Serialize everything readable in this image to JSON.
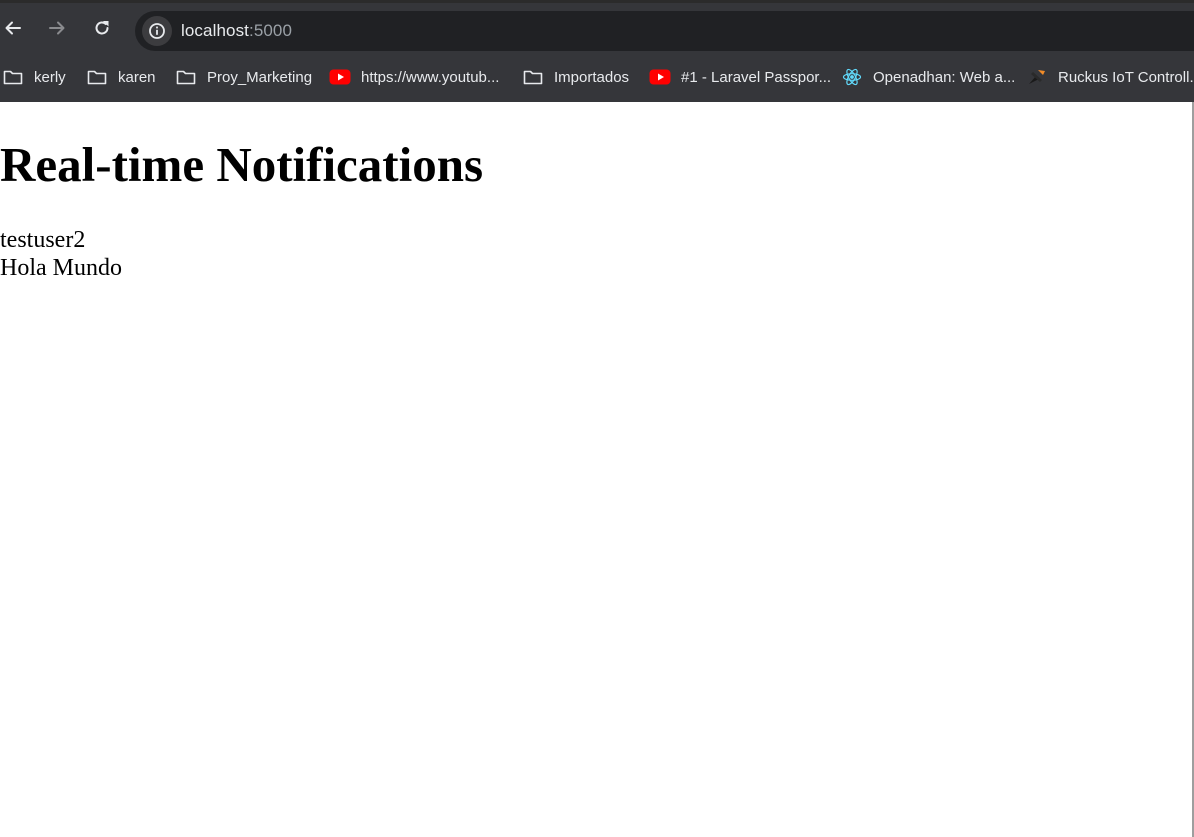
{
  "browser": {
    "url_host": "localhost",
    "url_port": ":5000",
    "bookmarks": [
      {
        "label": "kerly",
        "icon": "folder-icon"
      },
      {
        "label": "karen",
        "icon": "folder-icon"
      },
      {
        "label": "Proy_Marketing",
        "icon": "folder-icon"
      },
      {
        "label": "https://www.youtub...",
        "icon": "youtube-icon"
      },
      {
        "label": "Importados",
        "icon": "folder-icon"
      },
      {
        "label": "#1 - Laravel Passpor...",
        "icon": "youtube-icon"
      },
      {
        "label": "Openadhan: Web a...",
        "icon": "react-icon"
      },
      {
        "label": "Ruckus IoT Controll...",
        "icon": "ruckus-icon"
      }
    ],
    "colors": {
      "chrome_bg": "#35363a",
      "omnibox_bg": "#202124",
      "text": "#e8eaed",
      "youtube_red": "#ff0000",
      "react_blue": "#61dafb"
    }
  },
  "page": {
    "title": "Real-time Notifications",
    "notifications": [
      {
        "text": "testuser2"
      },
      {
        "text": "Hola Mundo"
      }
    ]
  }
}
